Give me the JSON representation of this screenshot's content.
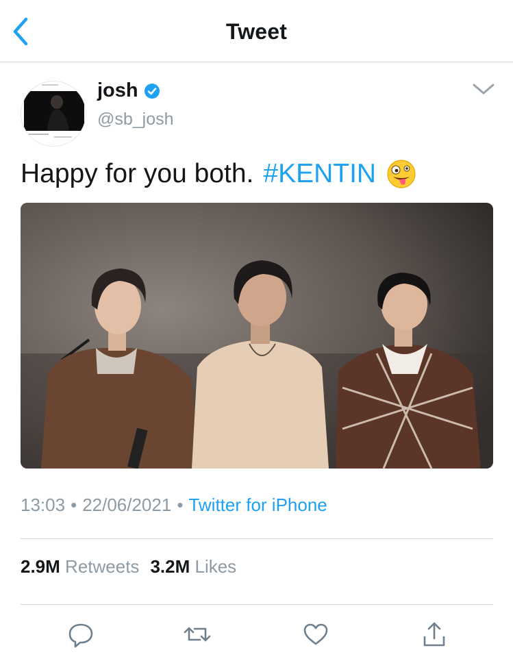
{
  "header": {
    "title": "Tweet",
    "back_icon": "chevron-left-icon"
  },
  "author": {
    "name": "josh",
    "handle": "@sb_josh",
    "verified": true
  },
  "tweet": {
    "text": "Happy for you both.",
    "hashtag": "#KENTIN",
    "emoji": "zany-face-emoji"
  },
  "meta": {
    "time": "13:03",
    "separator": "•",
    "date": "22/06/2021",
    "source": "Twitter for iPhone"
  },
  "stats": {
    "retweets_count": "2.9M",
    "retweets_label": "Retweets",
    "likes_count": "3.2M",
    "likes_label": "Likes"
  },
  "actions": [
    "reply-icon",
    "retweet-icon",
    "like-icon",
    "share-icon"
  ],
  "colors": {
    "accent": "#1da1f2",
    "muted": "#8e9aa4",
    "text": "#14171a",
    "divider": "#d6d6d6"
  }
}
